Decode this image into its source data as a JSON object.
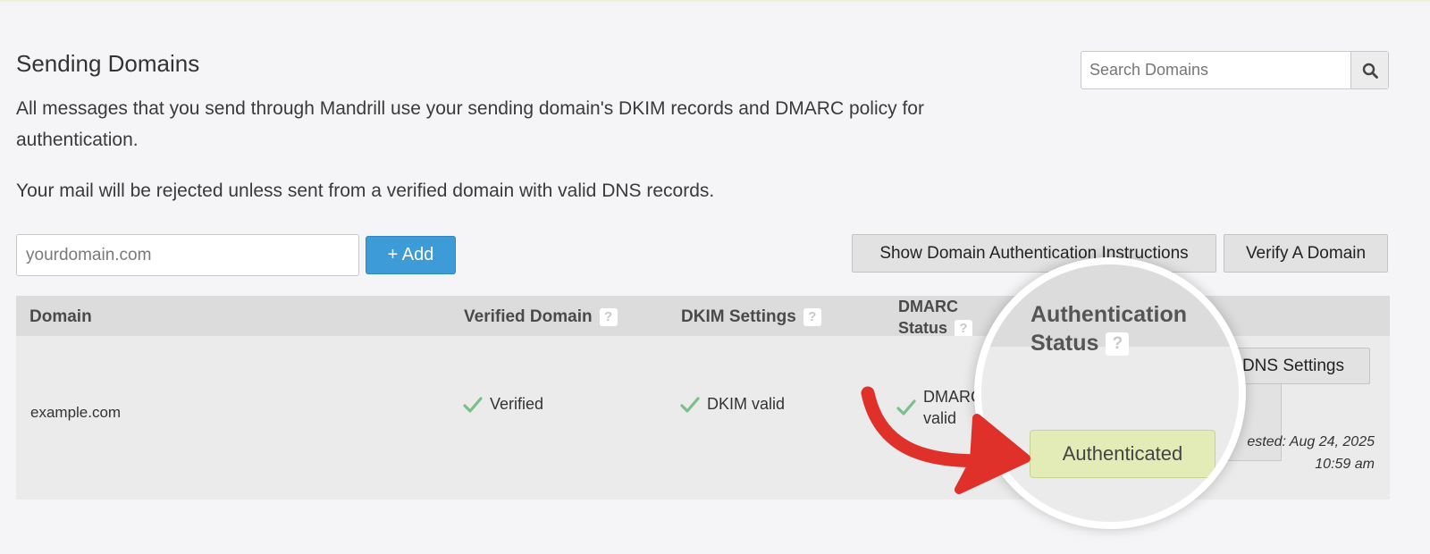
{
  "page": {
    "title": "Sending Domains",
    "description": "All messages that you send through Mandrill use your sending domain's DKIM records and DMARC policy for authentication.",
    "warning": "Your mail will be rejected unless sent from a verified domain with valid DNS records."
  },
  "search": {
    "placeholder": "Search Domains",
    "icon": "magnifier-icon"
  },
  "add_domain": {
    "placeholder": "yourdomain.com",
    "button_label": "+ Add"
  },
  "toolbar": {
    "show_instructions_label": "Show Domain Authentication Instructions",
    "verify_label": "Verify A Domain"
  },
  "table": {
    "headers": {
      "domain": "Domain",
      "verified": "Verified Domain",
      "dkim": "DKIM Settings",
      "dmarc_line1": "DMARC",
      "dmarc_line2": "Status",
      "auth_line1": "Authentication",
      "auth_line2": "Status",
      "help": "?"
    },
    "rows": [
      {
        "domain": "example.com",
        "verified": "Verified",
        "dkim": "DKIM valid",
        "dmarc_line1": "DMARC",
        "dmarc_line2": "valid",
        "auth_status": "Authenticated",
        "dns_button": "DNS Settings",
        "tested_line1": "ested: Aug 24, 2025",
        "tested_line2": "10:59 am"
      }
    ]
  },
  "colors": {
    "add_button": "#3d9bd8",
    "check": "#7bbf8a",
    "authenticated_badge": "#e3ebb6",
    "arrow": "#e0302a"
  }
}
